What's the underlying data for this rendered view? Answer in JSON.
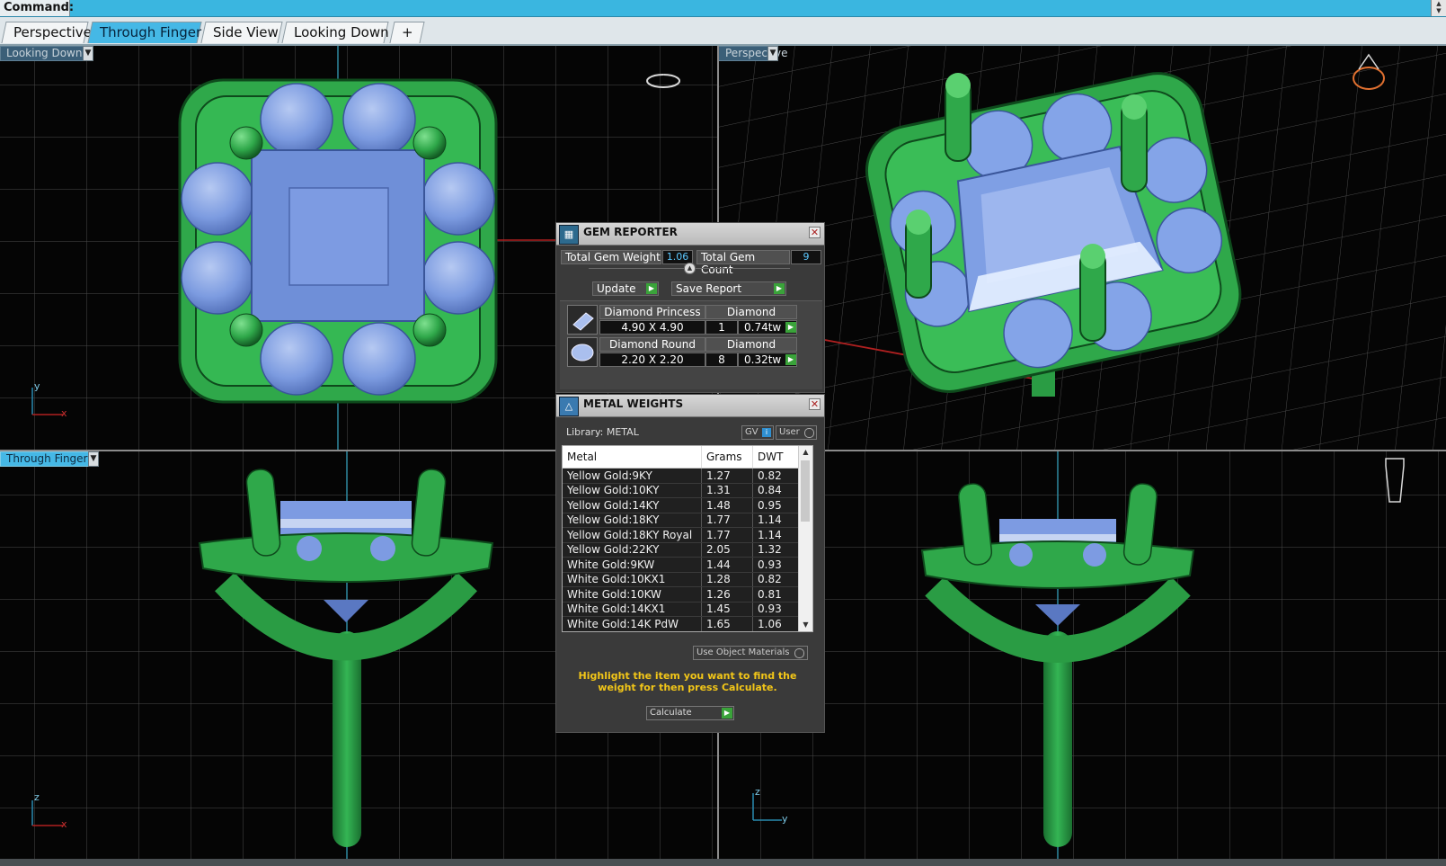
{
  "command_bar": {
    "label": "Command:"
  },
  "tabs": [
    {
      "label": "Perspective",
      "active": false
    },
    {
      "label": "Through Finger",
      "active": true
    },
    {
      "label": "Side View",
      "active": false
    },
    {
      "label": "Looking Down",
      "active": false
    }
  ],
  "tab_add_label": "+",
  "viewports": {
    "top_left": {
      "label": "Looking Down",
      "axis_v": "y",
      "axis_h": "x"
    },
    "top_right": {
      "label": "Perspective"
    },
    "bottom_left": {
      "label": "Through Finger",
      "axis_v": "z",
      "axis_h": "x"
    },
    "bottom_right": {
      "axis_v": "z",
      "axis_h": "y"
    }
  },
  "gem_reporter": {
    "title": "GEM REPORTER",
    "total_weight_label": "Total Gem Weight",
    "total_weight": "1.06",
    "total_count_label": "Total Gem Count",
    "total_count": "9",
    "update_label": "Update",
    "save_label": "Save Report",
    "gems": [
      {
        "name": "Diamond Princess",
        "material": "Diamond",
        "size": "4.90 X 4.90",
        "count": "1",
        "weight": "0.74tw"
      },
      {
        "name": "Diamond Round",
        "material": "Diamond",
        "size": "2.20 X 2.20",
        "count": "8",
        "weight": "0.32tw"
      }
    ]
  },
  "metal_weights": {
    "title": "METAL WEIGHTS",
    "library_label": "Library: METAL",
    "gv_label": "GV",
    "user_label": "User",
    "columns": [
      "Metal",
      "Grams",
      "DWT"
    ],
    "rows": [
      [
        "Yellow Gold:9KY",
        "1.27",
        "0.82"
      ],
      [
        "Yellow Gold:10KY",
        "1.31",
        "0.84"
      ],
      [
        "Yellow Gold:14KY",
        "1.48",
        "0.95"
      ],
      [
        "Yellow Gold:18KY",
        "1.77",
        "1.14"
      ],
      [
        "Yellow Gold:18KY Royal",
        "1.77",
        "1.14"
      ],
      [
        "Yellow Gold:22KY",
        "2.05",
        "1.32"
      ],
      [
        "White Gold:9KW",
        "1.44",
        "0.93"
      ],
      [
        "White Gold:10KX1",
        "1.28",
        "0.82"
      ],
      [
        "White Gold:10KW",
        "1.26",
        "0.81"
      ],
      [
        "White Gold:14KX1",
        "1.45",
        "0.93"
      ],
      [
        "White Gold:14K PdW",
        "1.65",
        "1.06"
      ]
    ],
    "use_object_materials_label": "Use Object Materials",
    "hint": "Highlight the item you want to find the weight for then press Calculate.",
    "calculate_label": "Calculate"
  },
  "colors": {
    "metal_green": "#2fa84a",
    "gem_blue": "#7c9be0",
    "grid": "#4a4a4a",
    "accent": "#45b8e6",
    "hint_yellow": "#f2c618"
  }
}
